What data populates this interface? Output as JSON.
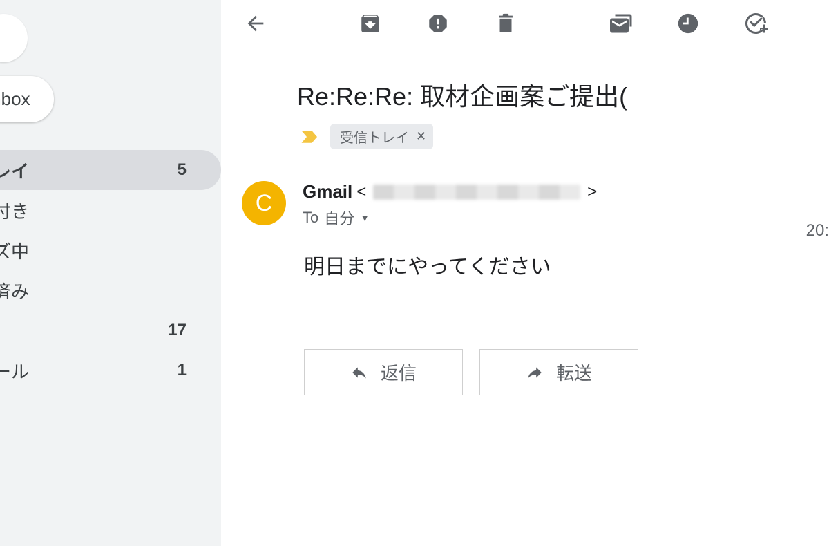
{
  "compose": {
    "label": "Inbox"
  },
  "sidebar": {
    "items": [
      {
        "label": "レイ",
        "count": "5",
        "active": true
      },
      {
        "label": "付き",
        "count": ""
      },
      {
        "label": "ズ中",
        "count": ""
      },
      {
        "label": "済み",
        "count": ""
      },
      {
        "label": "",
        "count": "17"
      },
      {
        "label": "ール",
        "count": "1"
      }
    ]
  },
  "toolbar": {
    "back": "back-icon",
    "archive": "archive-icon",
    "spam": "report-spam-icon",
    "delete": "delete-icon",
    "unread": "mark-unread-icon",
    "snooze": "snooze-icon",
    "addtask": "add-task-icon"
  },
  "mail": {
    "subject": "Re:Re:Re: 取材企画案ご提出(",
    "label_tag": "受信トレイ",
    "sender_name": "Gmail",
    "to_prefix": "To",
    "to_value": "自分",
    "timestamp": "20:",
    "body": "明日までにやってください",
    "avatar_letter": "C"
  },
  "actions": {
    "reply": "返信",
    "forward": "転送"
  }
}
